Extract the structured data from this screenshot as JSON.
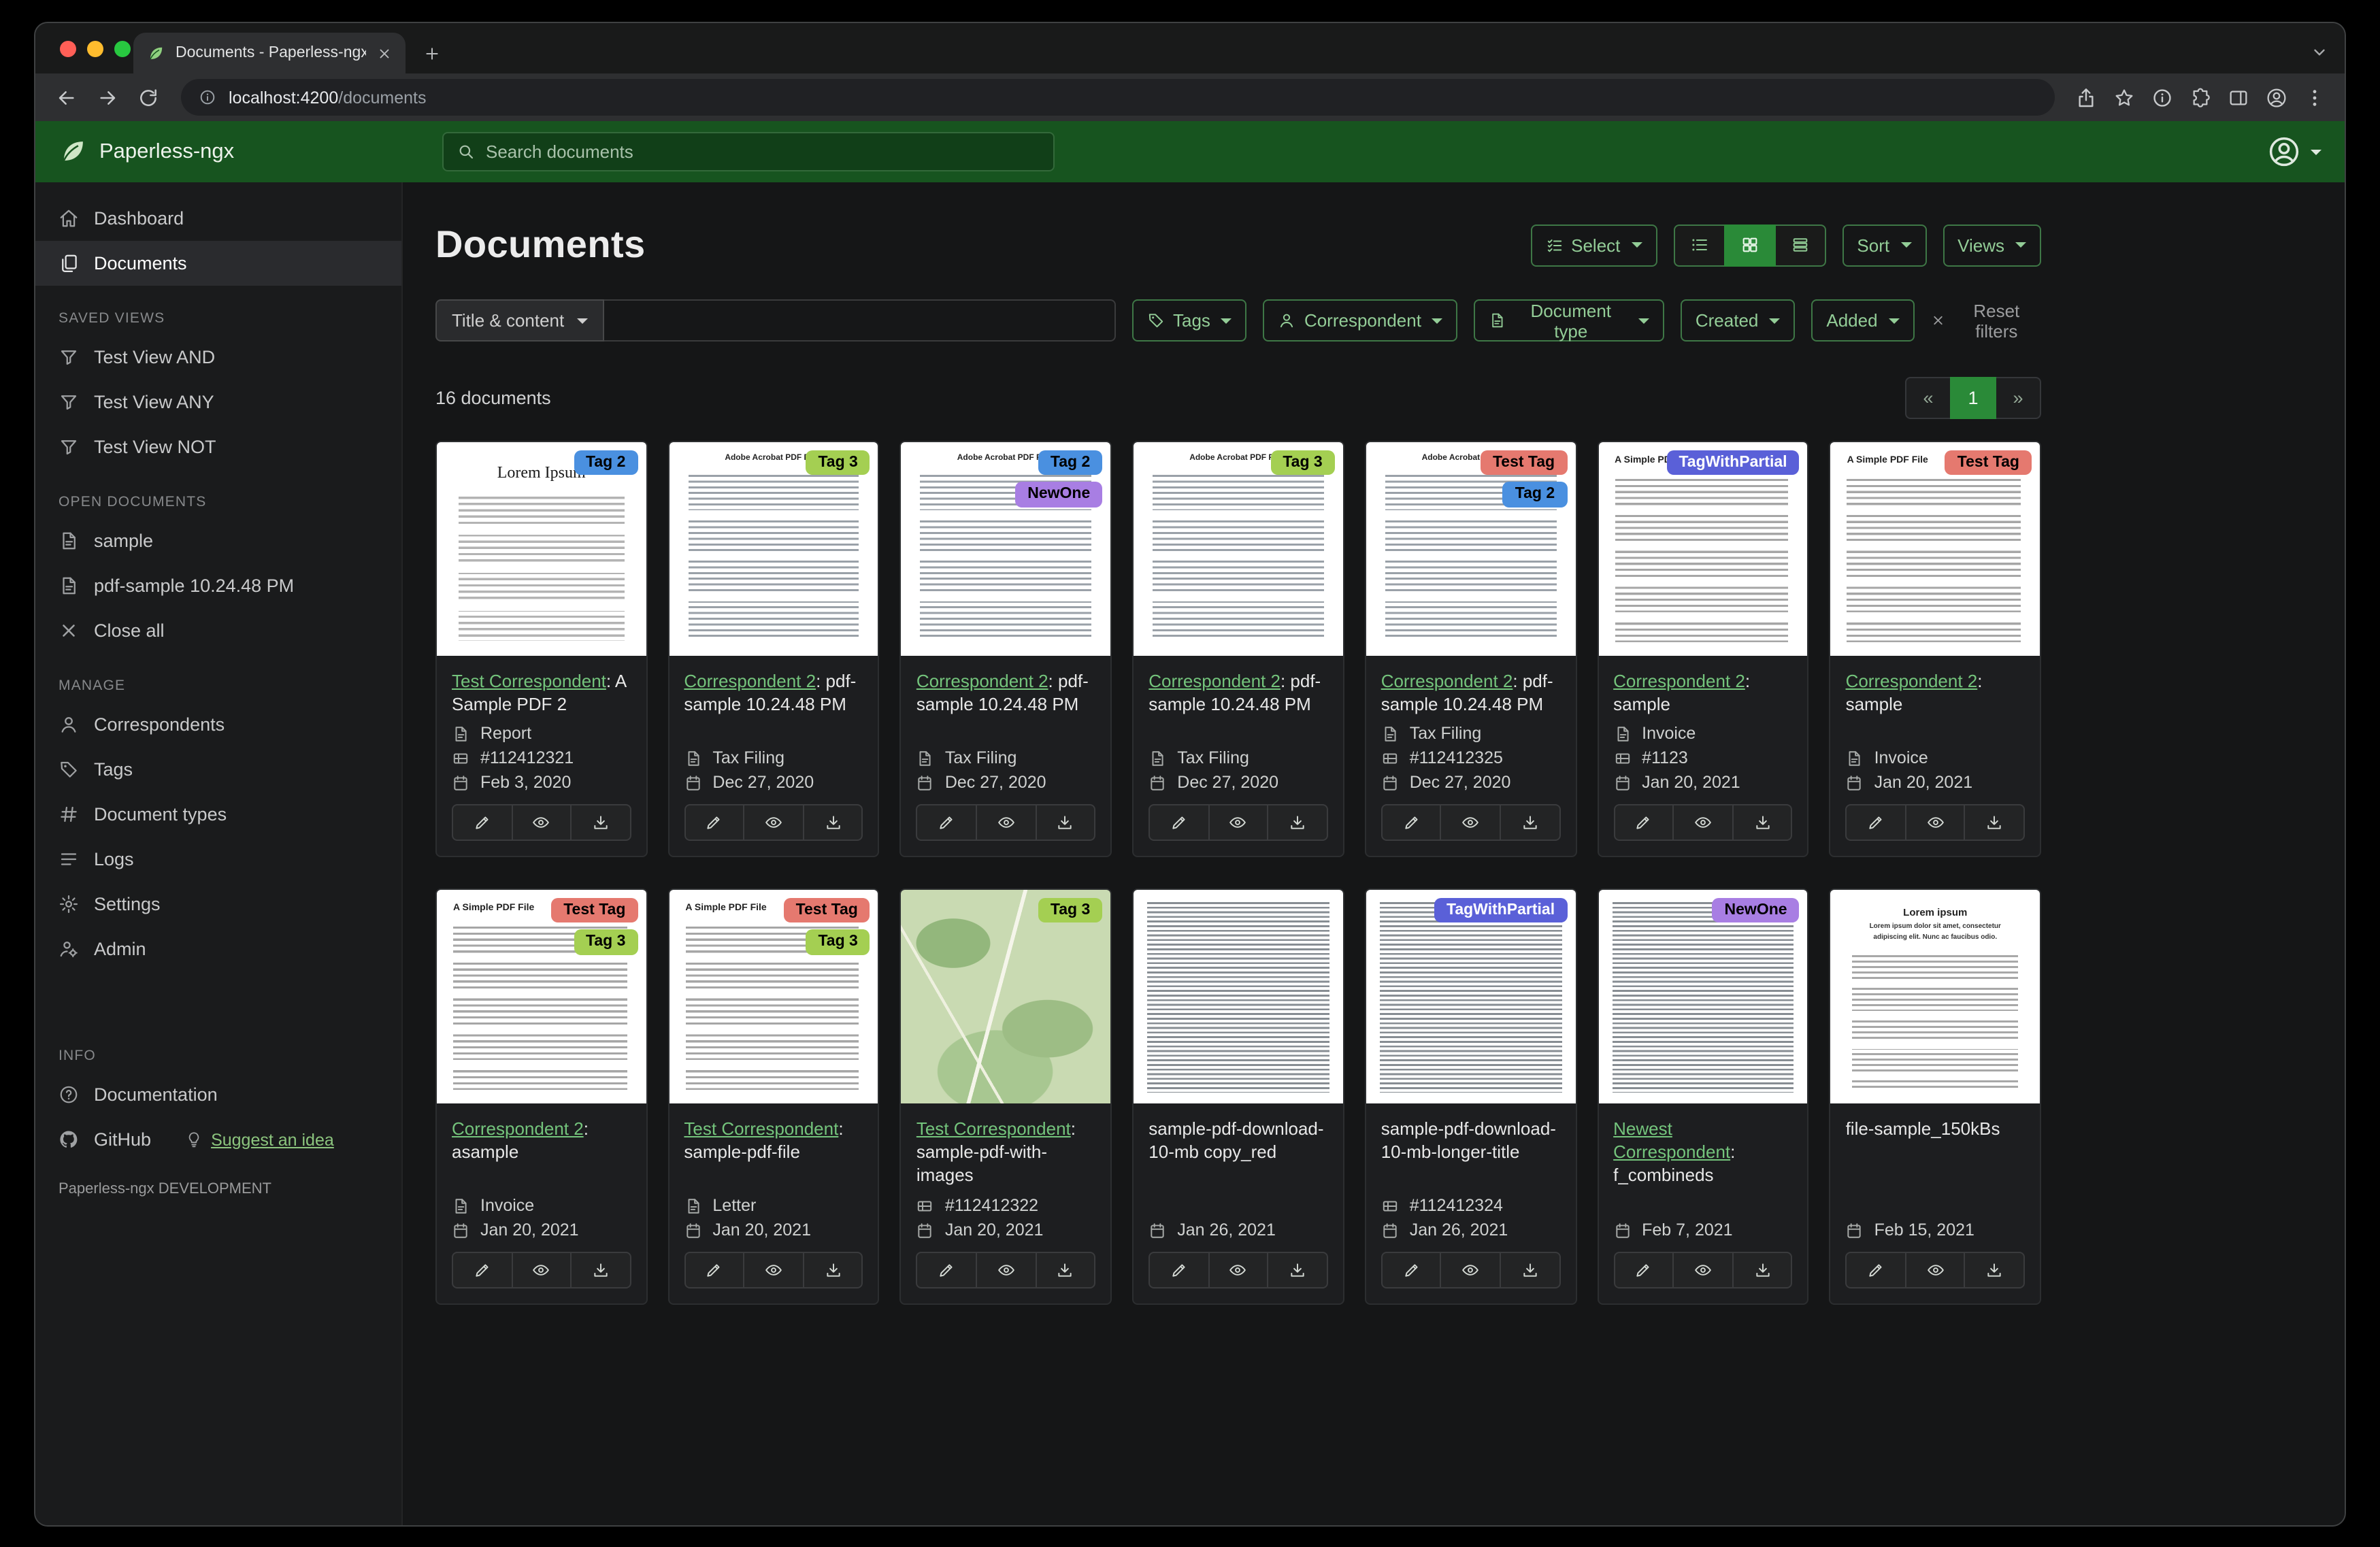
{
  "colors": {
    "brand": "#17541f",
    "accent_active": "#2a8a38",
    "link": "#74c47c"
  },
  "browser": {
    "tab_title": "Documents - Paperless-ngx",
    "url_host": "localhost:4200",
    "url_path": "/documents"
  },
  "header": {
    "brand": "Paperless-ngx",
    "search_placeholder": "Search documents"
  },
  "sidebar": {
    "dashboard": "Dashboard",
    "documents": "Documents",
    "saved_views_header": "SAVED VIEWS",
    "saved_views": [
      "Test View AND",
      "Test View ANY",
      "Test View NOT"
    ],
    "open_documents_header": "OPEN DOCUMENTS",
    "open_documents": [
      "sample",
      "pdf-sample 10.24.48 PM"
    ],
    "close_all": "Close all",
    "manage_header": "MANAGE",
    "manage": [
      "Correspondents",
      "Tags",
      "Document types",
      "Logs",
      "Settings",
      "Admin"
    ],
    "info_header": "INFO",
    "documentation": "Documentation",
    "github": "GitHub",
    "suggest": "Suggest an idea",
    "footer": "Paperless-ngx DEVELOPMENT"
  },
  "main": {
    "title": "Documents",
    "select_label": "Select",
    "sort_label": "Sort",
    "views_label": "Views",
    "filter": {
      "title_content": "Title & content",
      "tags": "Tags",
      "correspondent": "Correspondent",
      "document_type": "Document type",
      "created": "Created",
      "added": "Added",
      "reset": "Reset filters"
    },
    "count": "16 documents",
    "pagination": {
      "prev": "«",
      "page": "1",
      "next": "»"
    },
    "cards": [
      {
        "correspondent": "Test Correspondent",
        "suffix": ": A Sample PDF 2",
        "type": "Report",
        "asn": "#112412321",
        "date": "Feb 3, 2020",
        "tags": [
          {
            "label": "Tag 2",
            "bg": "#4a90e0",
            "fg": "#000000"
          }
        ],
        "thumb": {
          "variant": "serif",
          "heading": "Lorem Ipsum"
        }
      },
      {
        "correspondent": "Correspondent 2",
        "suffix": ": pdf-sample 10.24.48 PM",
        "type": "Tax Filing",
        "date": "Dec 27, 2020",
        "tags": [
          {
            "label": "Tag 3",
            "bg": "#a4cf52",
            "fg": "#000000"
          }
        ],
        "thumb": {
          "variant": "adobe",
          "heading": "Adobe Acrobat PDF Files"
        }
      },
      {
        "correspondent": "Correspondent 2",
        "suffix": ": pdf-sample 10.24.48 PM",
        "type": "Tax Filing",
        "date": "Dec 27, 2020",
        "tags": [
          {
            "label": "Tag 2",
            "bg": "#4a90e0",
            "fg": "#000000"
          },
          {
            "label": "NewOne",
            "bg": "#a87ee3",
            "fg": "#000000"
          }
        ],
        "thumb": {
          "variant": "adobe",
          "heading": "Adobe Acrobat PDF Files"
        }
      },
      {
        "correspondent": "Correspondent 2",
        "suffix": ": pdf-sample 10.24.48 PM",
        "type": "Tax Filing",
        "date": "Dec 27, 2020",
        "tags": [
          {
            "label": "Tag 3",
            "bg": "#a4cf52",
            "fg": "#000000"
          }
        ],
        "thumb": {
          "variant": "adobe",
          "heading": "Adobe Acrobat PDF Files"
        }
      },
      {
        "correspondent": "Correspondent 2",
        "suffix": ": pdf-sample 10.24.48 PM",
        "type": "Tax Filing",
        "asn": "#112412325",
        "date": "Dec 27, 2020",
        "tags": [
          {
            "label": "Test Tag",
            "bg": "#e5796f",
            "fg": "#000000"
          },
          {
            "label": "Tag 2",
            "bg": "#4a90e0",
            "fg": "#000000"
          }
        ],
        "thumb": {
          "variant": "adobe",
          "heading": "Adobe Acrobat PDF Files"
        }
      },
      {
        "correspondent": "Correspondent 2",
        "suffix": ": sample",
        "type": "Invoice",
        "asn": "#1123",
        "date": "Jan 20, 2021",
        "tags": [
          {
            "label": "TagWithPartial",
            "bg": "#5a60d8",
            "fg": "#ffffff"
          }
        ],
        "thumb": {
          "variant": "simple",
          "heading": "A Simple PDF File"
        }
      },
      {
        "correspondent": "Correspondent 2",
        "suffix": ": sample",
        "type": "Invoice",
        "date": "Jan 20, 2021",
        "tags": [
          {
            "label": "Test Tag",
            "bg": "#e5796f",
            "fg": "#000000"
          }
        ],
        "thumb": {
          "variant": "simple",
          "heading": "A Simple PDF File"
        }
      },
      {
        "correspondent": "Correspondent 2",
        "suffix": ": asample",
        "type": "Invoice",
        "date": "Jan 20, 2021",
        "tags": [
          {
            "label": "Test Tag",
            "bg": "#e5796f",
            "fg": "#000000"
          },
          {
            "label": "Tag 3",
            "bg": "#a4cf52",
            "fg": "#000000"
          }
        ],
        "thumb": {
          "variant": "simple",
          "heading": "A Simple PDF File"
        }
      },
      {
        "correspondent": "Test Correspondent",
        "suffix": ": sample-pdf-file",
        "type": "Letter",
        "date": "Jan 20, 2021",
        "tags": [
          {
            "label": "Test Tag",
            "bg": "#e5796f",
            "fg": "#000000"
          },
          {
            "label": "Tag 3",
            "bg": "#a4cf52",
            "fg": "#000000"
          }
        ],
        "thumb": {
          "variant": "simple",
          "heading": "A Simple PDF File"
        }
      },
      {
        "correspondent": "Test Correspondent",
        "suffix": ": sample-pdf-with-images",
        "asn": "#112412322",
        "date": "Jan 20, 2021",
        "tags": [
          {
            "label": "Tag 3",
            "bg": "#a4cf52",
            "fg": "#000000"
          }
        ],
        "thumb": {
          "variant": "map",
          "heading": ""
        }
      },
      {
        "title": "sample-pdf-download-10-mb copy_red",
        "date": "Jan 26, 2021",
        "tags": [],
        "thumb": {
          "variant": "dense",
          "heading": ""
        }
      },
      {
        "title": "sample-pdf-download-10-mb-longer-title",
        "asn": "#112412324",
        "date": "Jan 26, 2021",
        "tags": [
          {
            "label": "TagWithPartial",
            "bg": "#5a60d8",
            "fg": "#ffffff"
          }
        ],
        "thumb": {
          "variant": "dense",
          "heading": ""
        }
      },
      {
        "correspondent": "Newest Correspondent",
        "suffix": ": f_combineds",
        "date": "Feb 7, 2021",
        "tags": [
          {
            "label": "NewOne",
            "bg": "#a87ee3",
            "fg": "#000000"
          }
        ],
        "thumb": {
          "variant": "dense",
          "heading": ""
        }
      },
      {
        "title": "file-sample_150kBs",
        "date": "Feb 15, 2021",
        "tags": [],
        "thumb": {
          "variant": "lorem2",
          "heading": "Lorem ipsum",
          "sub": "Lorem ipsum dolor sit amet, consectetur adipiscing elit. Nunc ac faucibus odio."
        }
      }
    ]
  }
}
